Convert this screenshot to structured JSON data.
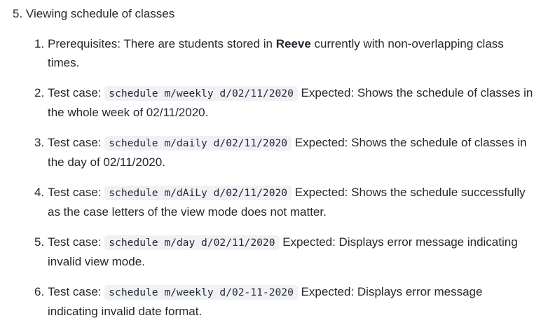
{
  "section": {
    "number": "5.",
    "title": "Viewing schedule of classes"
  },
  "items": [
    {
      "number": "1.",
      "lead": "Prerequisites: There are students stored in ",
      "bold": "Reeve",
      "rest": " currently with non-overlapping class times."
    },
    {
      "number": "2.",
      "lead": "Test case: ",
      "command": "schedule m/weekly d/02/11/2020",
      "rest": " Expected: Shows the schedule of classes in the whole week of 02/11/2020."
    },
    {
      "number": "3.",
      "lead": "Test case: ",
      "command": "schedule m/daily d/02/11/2020",
      "rest": " Expected: Shows the schedule of classes in the day of 02/11/2020."
    },
    {
      "number": "4.",
      "lead": "Test case: ",
      "command": "schedule m/dAiLy d/02/11/2020",
      "rest": " Expected: Shows the schedule successfully as the case letters of the view mode does not matter."
    },
    {
      "number": "5.",
      "lead": "Test case: ",
      "command": "schedule m/day d/02/11/2020",
      "rest": " Expected: Displays error message indicating invalid view mode."
    },
    {
      "number": "6.",
      "lead": "Test case: ",
      "command": "schedule m/weekly d/02-11-2020",
      "rest": " Expected: Displays error message indicating invalid date format."
    }
  ]
}
